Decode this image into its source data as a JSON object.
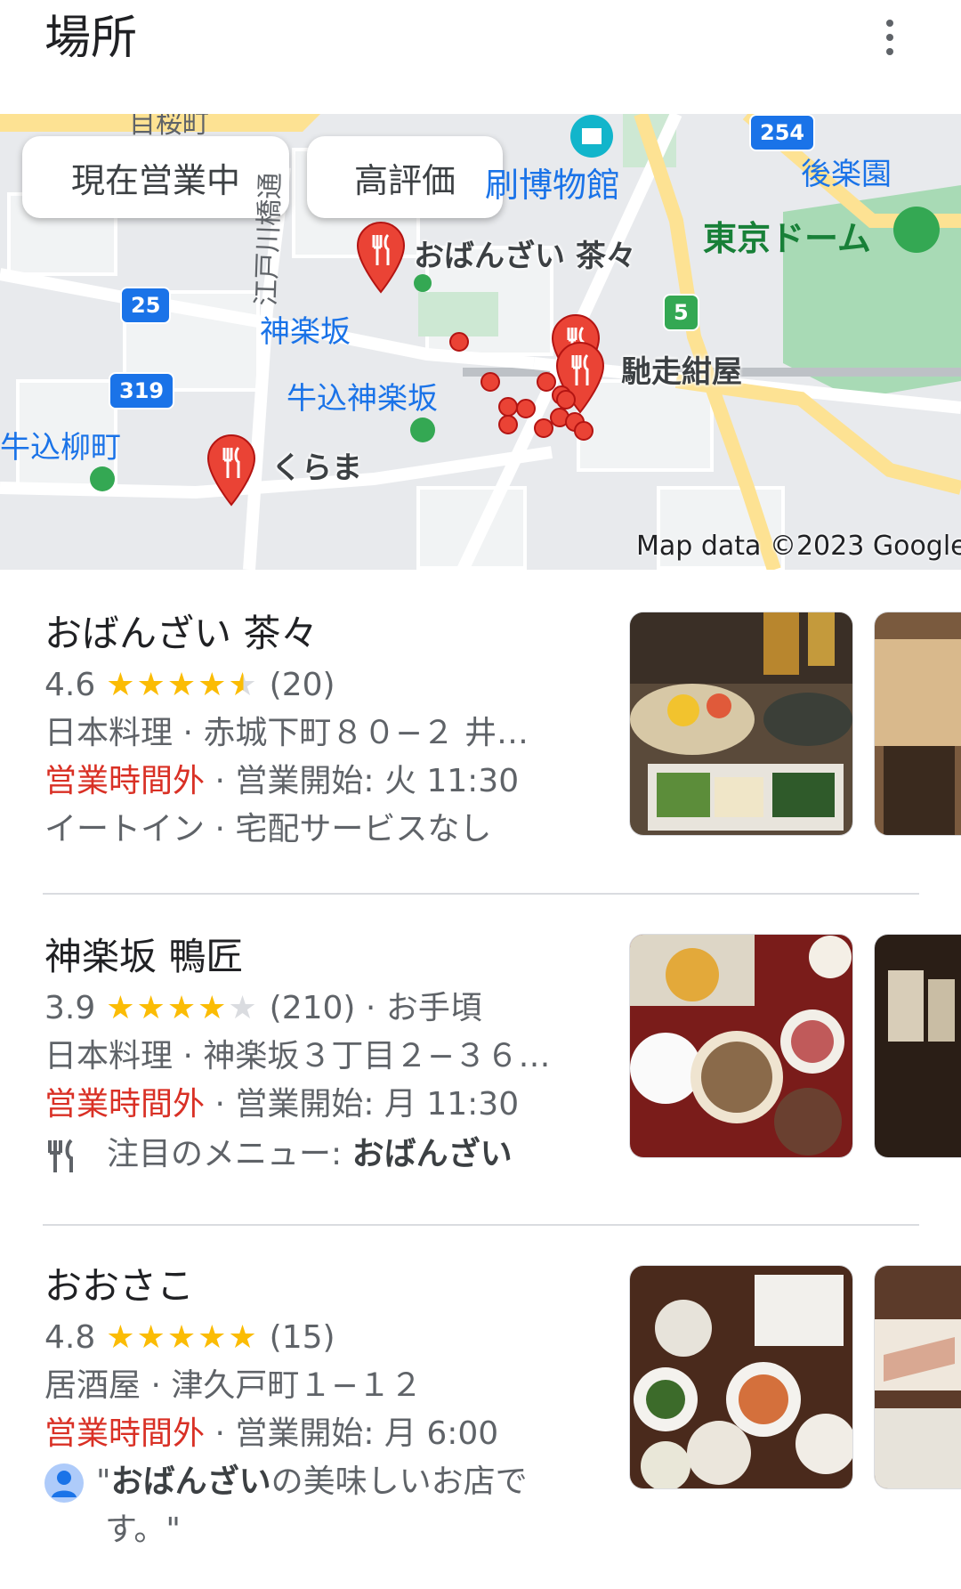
{
  "header": {
    "title": "場所",
    "more_icon": "more-vert-icon"
  },
  "map": {
    "filters": [
      "現在営業中",
      "高評価"
    ],
    "labels": {
      "museum": "刷博物館",
      "korakuen": "後楽園",
      "tokyo_dome": "東京ドーム",
      "edogawabashi": "江戸川橋通",
      "kagurazaka": "神楽坂",
      "ushigome_kagurazaka": "牛込神楽坂",
      "ushigome_yanagicho": "牛込柳町",
      "pin_obanzai": "おばんざい 茶々",
      "pin_chisou": "馳走紺屋",
      "pin_kurama": "くらま",
      "top_partial": "目桜町"
    },
    "route_shields": [
      "254",
      "25",
      "319",
      "5"
    ],
    "credit": "Map data ©2023 Google",
    "colors": {
      "pin": "#ea4335",
      "water_park": "#a8dab5",
      "road_major": "#fde293"
    }
  },
  "results": [
    {
      "name": "おばんざい 茶々",
      "rating": "4.6",
      "rating_value": 4.5,
      "reviews": "(20)",
      "extra": "",
      "address": "日本料理 · 赤城下町８０−２ 井…",
      "status": "営業時間外",
      "hours": " · 営業開始: 火 11:30",
      "footer": "イートイン · 宅配サービスなし"
    },
    {
      "name": "神楽坂 鴨匠",
      "rating": "3.9",
      "rating_value": 4,
      "reviews": "(210)",
      "extra": " · お手頃",
      "address": "日本料理 · 神楽坂３丁目２−３６…",
      "status": "営業時間外",
      "hours": " · 営業開始: 月 11:30",
      "menu_prefix": "注目のメニュー: ",
      "menu_item": "おばんざい"
    },
    {
      "name": "おおさこ",
      "rating": "4.8",
      "rating_value": 5,
      "reviews": "(15)",
      "extra": "",
      "address": "居酒屋 · 津久戸町１−１２",
      "status": "営業時間外",
      "hours": " · 営業開始: 月 6:00",
      "review_open": "\"",
      "review_bold": "おばんざい",
      "review_rest": "の美味しいお店で",
      "review_line2": "す。\""
    }
  ]
}
